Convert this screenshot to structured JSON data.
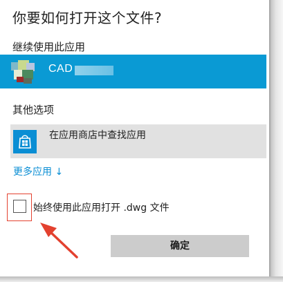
{
  "dialog": {
    "title": "你要如何打开这个文件?",
    "continue_section": "继续使用此应用",
    "current_app": {
      "name": "CAD",
      "icon": "cad-app-icon"
    },
    "other_section": "其他选项",
    "store_option": {
      "label": "在应用商店中查找应用",
      "icon": "store-bag-icon"
    },
    "more_apps_link": "更多应用 ↓",
    "always_use": {
      "label": "始终使用此应用打开 .dwg 文件",
      "checked": false
    },
    "ok_button": "确定"
  },
  "annotation": {
    "highlight_color": "#e3412f",
    "icon": "red-arrow-icon"
  },
  "colors": {
    "accent": "#0a9ad4",
    "row_gray": "#e1e1e1",
    "button_gray": "#cccccc"
  }
}
